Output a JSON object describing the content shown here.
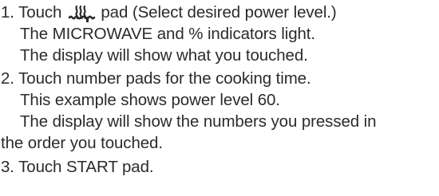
{
  "steps": [
    {
      "number": "1.",
      "line1_before_icon": "Touch",
      "icon": "microwave-power-icon",
      "line1_after_icon": "pad (Select desired power level.)",
      "lines": [
        "The MICROWAVE and % indicators light.",
        "The display will show what you touched."
      ]
    },
    {
      "number": "2.",
      "line1": "Touch number pads for the cooking time.",
      "lines": [
        "This example shows power level 60.",
        "The display will show the numbers you pressed in",
        "the order you touched."
      ]
    },
    {
      "number": "3.",
      "line1": "Touch START pad."
    }
  ]
}
